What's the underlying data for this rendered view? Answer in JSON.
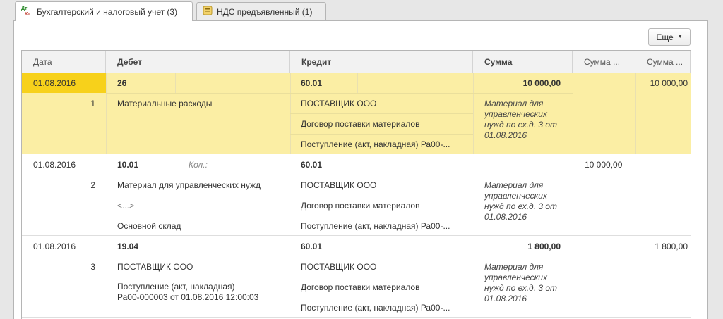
{
  "tabs": [
    {
      "label": "Бухгалтерский и налоговый учет (3)",
      "icon": "dt-kt-icon",
      "active": true
    },
    {
      "label": "НДС предъявленный (1)",
      "icon": "vat-doc-icon",
      "active": false
    }
  ],
  "toolbar": {
    "more_label": "Еще"
  },
  "columns": {
    "date": "Дата",
    "debit": "Дебет",
    "credit": "Кредит",
    "sum": "Сумма",
    "sum_dt": "Сумма ...",
    "sum_kt": "Сумма ..."
  },
  "rows": [
    {
      "date": "01.08.2016",
      "num": "1",
      "debit_account": "26",
      "debit_sub1": "Материальные расходы",
      "credit_account": "60.01",
      "credit_sub1": "ПОСТАВЩИК ООО",
      "credit_sub2": "Договор поставки материалов",
      "credit_sub3": "Поступление (акт, накладная) Ра00-...",
      "sum": "10 000,00",
      "comment": "Материал для управленческих нужд по ех.д. 3 от 01.08.2016",
      "sum_kt": "10 000,00"
    },
    {
      "date": "01.08.2016",
      "num": "2",
      "debit_account": "10.01",
      "qty_label": "Кол.:",
      "debit_sub1": "Материал для управленческих нужд",
      "debit_sub2": "<...>",
      "debit_sub3": "Основной склад",
      "credit_account": "60.01",
      "credit_sub1": "ПОСТАВЩИК ООО",
      "credit_sub2": "Договор поставки материалов",
      "credit_sub3": "Поступление (акт, накладная) Ра00-...",
      "comment": "Материал для управленческих нужд по ех.д. 3 от 01.08.2016",
      "sum_dt": "10 000,00"
    },
    {
      "date": "01.08.2016",
      "num": "3",
      "debit_account": "19.04",
      "debit_sub1": "ПОСТАВЩИК ООО",
      "debit_sub2a": "Поступление (акт, накладная)",
      "debit_sub2b": "Ра00-000003 от 01.08.2016 12:00:03",
      "credit_account": "60.01",
      "credit_sub1": "ПОСТАВЩИК ООО",
      "credit_sub2": "Договор поставки материалов",
      "credit_sub3": "Поступление (акт, накладная) Ра00-...",
      "sum": "1 800,00",
      "comment": "Материал для управленческих нужд по ех.д. 3 от 01.08.2016",
      "sum_kt": "1 800,00"
    }
  ],
  "colors": {
    "selected_row": "#fbeea4",
    "selected_date": "#f7d11b"
  }
}
